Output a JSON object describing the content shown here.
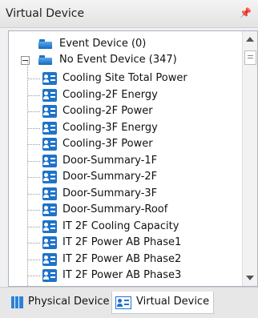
{
  "panel": {
    "title": "Virtual Device",
    "pin_icon": "pin-icon"
  },
  "tree": {
    "roots": [
      {
        "label": "Event Device (0)",
        "icon": "folder-icon"
      },
      {
        "label": "No Event Device (347)",
        "icon": "folder-icon",
        "expanded": true
      }
    ],
    "children": [
      "Cooling Site Total Power",
      "Cooling-2F Energy",
      "Cooling-2F Power",
      "Cooling-3F Energy",
      "Cooling-3F Power",
      "Door-Summary-1F",
      "Door-Summary-2F",
      "Door-Summary-3F",
      "Door-Summary-Roof",
      "IT 2F Cooling Capacity",
      "IT 2F Power AB Phase1",
      "IT 2F Power AB Phase2",
      "IT 2F Power AB Phase3"
    ]
  },
  "tabs": [
    {
      "label": "Physical Device",
      "icon": "physical-device-icon",
      "active": false
    },
    {
      "label": "Virtual Device",
      "icon": "virtual-device-icon",
      "active": true
    }
  ],
  "colors": {
    "accent": "#1f73c9",
    "border": "#a9b4c2"
  }
}
